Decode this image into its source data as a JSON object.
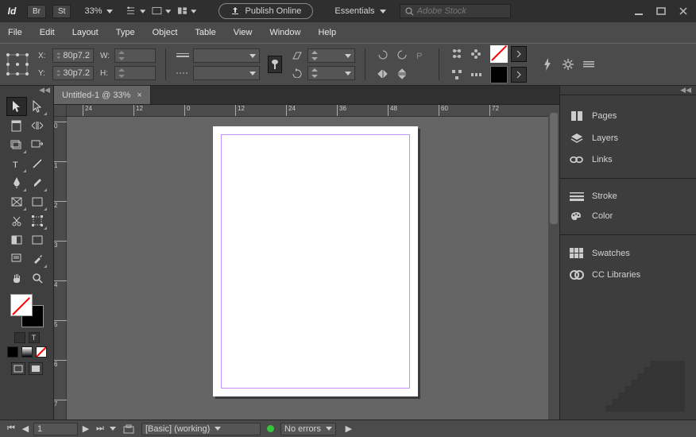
{
  "topbar": {
    "zoom": "33%",
    "publish_label": "Publish Online",
    "workspace_label": "Essentials",
    "search_placeholder": "Adobe Stock"
  },
  "menu": [
    "File",
    "Edit",
    "Layout",
    "Type",
    "Object",
    "Table",
    "View",
    "Window",
    "Help"
  ],
  "coords": {
    "x_label": "X:",
    "x_val": "80p7.2",
    "y_label": "Y:",
    "y_val": "30p7.2",
    "w_label": "W:",
    "w_val": "",
    "h_label": "H:",
    "h_val": ""
  },
  "document": {
    "tab_title": "Untitled-1 @ 33%",
    "ruler_h": [
      "24",
      "12",
      "0",
      "12",
      "24",
      "36",
      "48",
      "60",
      "72"
    ],
    "ruler_v": [
      "0",
      "1",
      "2",
      "3",
      "4",
      "5",
      "6",
      "7"
    ]
  },
  "panels": [
    "Pages",
    "Layers",
    "Links",
    "Stroke",
    "Color",
    "Swatches",
    "CC Libraries"
  ],
  "status": {
    "page_current": "1",
    "style": "[Basic] (working)",
    "errors": "No errors"
  }
}
